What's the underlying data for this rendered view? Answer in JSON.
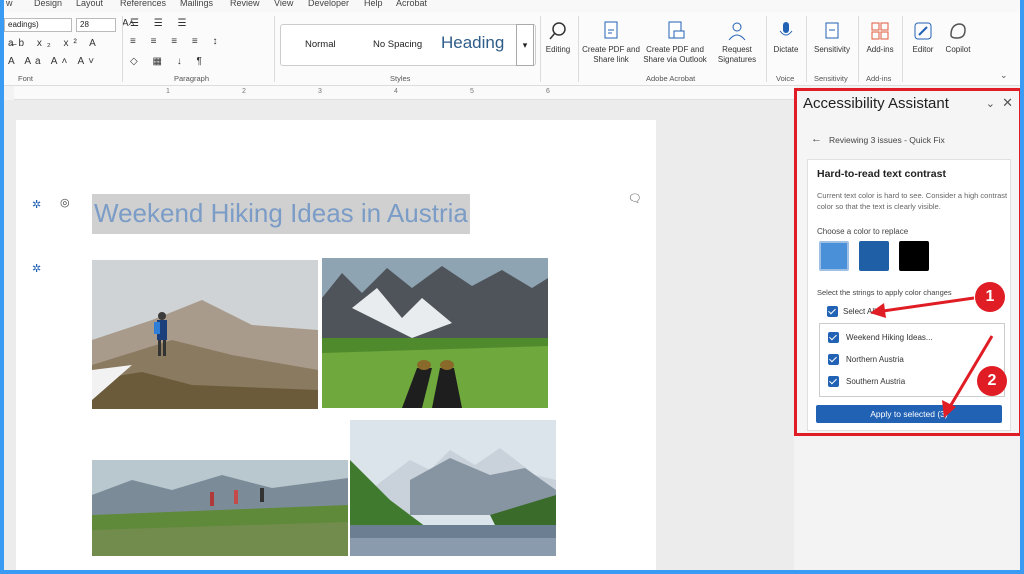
{
  "ribbon": {
    "tabs": [
      "w",
      "Design",
      "Layout",
      "References",
      "Mailings",
      "Review",
      "View",
      "Developer",
      "Help",
      "Acrobat"
    ],
    "font_name": "eadings)",
    "font_size": "28",
    "groups": {
      "font": "Font",
      "paragraph": "Paragraph",
      "styles": "Styles",
      "acrobat": "Adobe Acrobat",
      "voice": "Voice",
      "sensitivity": "Sensitivity",
      "addins": "Add-ins"
    },
    "styles": [
      "Normal",
      "No Spacing",
      "Heading"
    ],
    "editing": "Editing",
    "create_pdf_share": "Create PDF and Share link",
    "create_pdf_outlook": "Create PDF and Share via Outlook",
    "request_signatures": "Request Signatures",
    "dictate": "Dictate",
    "sensitivity_btn": "Sensitivity",
    "addins_btn": "Add-ins",
    "editor": "Editor",
    "copilot": "Copilot"
  },
  "ruler": {
    "ticks": [
      "1",
      "2",
      "3",
      "4",
      "5",
      "6"
    ]
  },
  "document": {
    "title": "Weekend Hiking Ideas in Austria"
  },
  "panel": {
    "title": "Accessibility Assistant",
    "breadcrumb": "Reviewing 3 issues - Quick Fix",
    "issue_title": "Hard-to-read text contrast",
    "issue_desc": "Current text color is hard to see. Consider a high contrast color so that the text is clearly visible.",
    "choose_color": "Choose a color to replace",
    "swatches": [
      "#4a90d9",
      "#1f5fa5",
      "#000000"
    ],
    "select_strings": "Select the strings to apply color changes",
    "select_all": "Select All",
    "items": [
      "Weekend Hiking Ideas...",
      "Northern Austria",
      "Southern Austria"
    ],
    "apply": "Apply to selected (3)"
  },
  "callouts": [
    "1",
    "2"
  ],
  "colors": {
    "accent": "#2162b5",
    "highlight": "#e01c24"
  }
}
